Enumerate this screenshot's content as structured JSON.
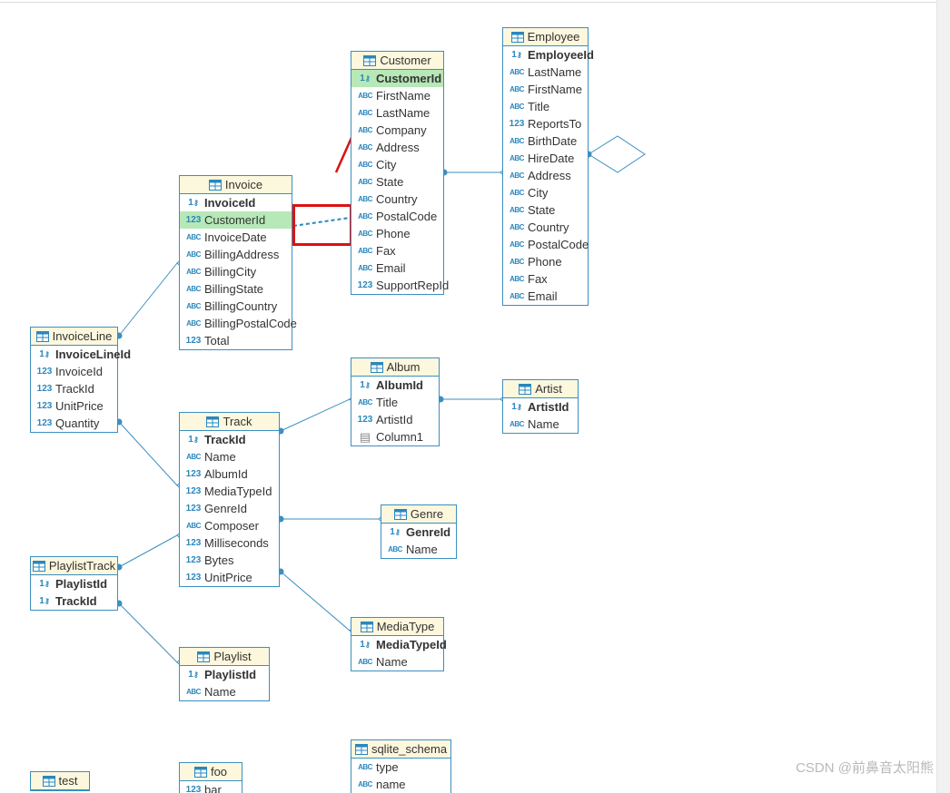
{
  "watermark": "CSDN @前鼻音太阳熊",
  "tables": {
    "employee": {
      "name": "Employee",
      "cols": [
        {
          "t": "pk",
          "n": "EmployeeId"
        },
        {
          "t": "abc",
          "n": "LastName"
        },
        {
          "t": "abc",
          "n": "FirstName"
        },
        {
          "t": "abc",
          "n": "Title"
        },
        {
          "t": "num",
          "n": "ReportsTo"
        },
        {
          "t": "abc",
          "n": "BirthDate"
        },
        {
          "t": "abc",
          "n": "HireDate"
        },
        {
          "t": "abc",
          "n": "Address"
        },
        {
          "t": "abc",
          "n": "City"
        },
        {
          "t": "abc",
          "n": "State"
        },
        {
          "t": "abc",
          "n": "Country"
        },
        {
          "t": "abc",
          "n": "PostalCode"
        },
        {
          "t": "abc",
          "n": "Phone"
        },
        {
          "t": "abc",
          "n": "Fax"
        },
        {
          "t": "abc",
          "n": "Email"
        }
      ]
    },
    "customer": {
      "name": "Customer",
      "cols": [
        {
          "t": "pk",
          "n": "CustomerId",
          "hl": true
        },
        {
          "t": "abc",
          "n": "FirstName"
        },
        {
          "t": "abc",
          "n": "LastName"
        },
        {
          "t": "abc",
          "n": "Company"
        },
        {
          "t": "abc",
          "n": "Address"
        },
        {
          "t": "abc",
          "n": "City"
        },
        {
          "t": "abc",
          "n": "State"
        },
        {
          "t": "abc",
          "n": "Country"
        },
        {
          "t": "abc",
          "n": "PostalCode"
        },
        {
          "t": "abc",
          "n": "Phone"
        },
        {
          "t": "abc",
          "n": "Fax"
        },
        {
          "t": "abc",
          "n": "Email"
        },
        {
          "t": "num",
          "n": "SupportRepId"
        }
      ]
    },
    "invoice": {
      "name": "Invoice",
      "cols": [
        {
          "t": "pk",
          "n": "InvoiceId"
        },
        {
          "t": "num",
          "n": "CustomerId",
          "hl": true
        },
        {
          "t": "abc",
          "n": "InvoiceDate"
        },
        {
          "t": "abc",
          "n": "BillingAddress"
        },
        {
          "t": "abc",
          "n": "BillingCity"
        },
        {
          "t": "abc",
          "n": "BillingState"
        },
        {
          "t": "abc",
          "n": "BillingCountry"
        },
        {
          "t": "abc",
          "n": "BillingPostalCode"
        },
        {
          "t": "num",
          "n": "Total"
        }
      ]
    },
    "invoiceline": {
      "name": "InvoiceLine",
      "cols": [
        {
          "t": "pk",
          "n": "InvoiceLineId"
        },
        {
          "t": "num",
          "n": "InvoiceId"
        },
        {
          "t": "num",
          "n": "TrackId"
        },
        {
          "t": "num",
          "n": "UnitPrice"
        },
        {
          "t": "num",
          "n": "Quantity"
        }
      ]
    },
    "album": {
      "name": "Album",
      "cols": [
        {
          "t": "pk",
          "n": "AlbumId"
        },
        {
          "t": "abc",
          "n": "Title"
        },
        {
          "t": "num",
          "n": "ArtistId"
        },
        {
          "t": "doc",
          "n": "Column1"
        }
      ]
    },
    "artist": {
      "name": "Artist",
      "cols": [
        {
          "t": "pk",
          "n": "ArtistId"
        },
        {
          "t": "abc",
          "n": "Name"
        }
      ]
    },
    "track": {
      "name": "Track",
      "cols": [
        {
          "t": "pk",
          "n": "TrackId"
        },
        {
          "t": "abc",
          "n": "Name"
        },
        {
          "t": "num",
          "n": "AlbumId"
        },
        {
          "t": "num",
          "n": "MediaTypeId"
        },
        {
          "t": "num",
          "n": "GenreId"
        },
        {
          "t": "abc",
          "n": "Composer"
        },
        {
          "t": "num",
          "n": "Milliseconds"
        },
        {
          "t": "num",
          "n": "Bytes"
        },
        {
          "t": "num",
          "n": "UnitPrice"
        }
      ]
    },
    "genre": {
      "name": "Genre",
      "cols": [
        {
          "t": "pk",
          "n": "GenreId"
        },
        {
          "t": "abc",
          "n": "Name"
        }
      ]
    },
    "mediatype": {
      "name": "MediaType",
      "cols": [
        {
          "t": "pk",
          "n": "MediaTypeId"
        },
        {
          "t": "abc",
          "n": "Name"
        }
      ]
    },
    "playlisttrack": {
      "name": "PlaylistTrack",
      "cols": [
        {
          "t": "pk",
          "n": "PlaylistId"
        },
        {
          "t": "pk",
          "n": "TrackId"
        }
      ]
    },
    "playlist": {
      "name": "Playlist",
      "cols": [
        {
          "t": "pk",
          "n": "PlaylistId"
        },
        {
          "t": "abc",
          "n": "Name"
        }
      ]
    },
    "sqliteschema": {
      "name": "sqlite_schema",
      "cols": [
        {
          "t": "abc",
          "n": "type"
        },
        {
          "t": "abc",
          "n": "name"
        }
      ]
    },
    "foo": {
      "name": "foo",
      "cols": [
        {
          "t": "num",
          "n": "bar"
        }
      ]
    },
    "test": {
      "name": "test",
      "cols": []
    }
  }
}
